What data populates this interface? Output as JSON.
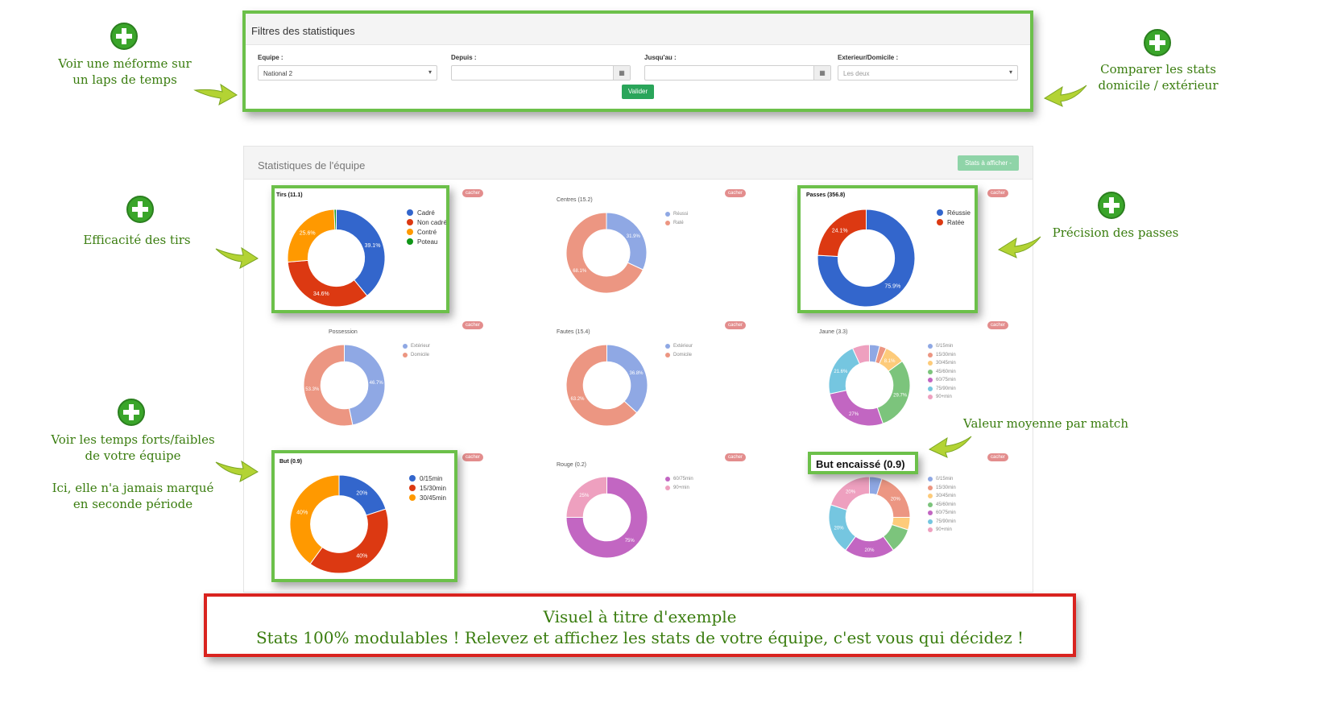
{
  "filters": {
    "title": "Filtres des statistiques",
    "team_label": "Equipe :",
    "team_value": "National 2",
    "from_label": "Depuis :",
    "from_value": "",
    "to_label": "Jusqu'au :",
    "to_value": "",
    "venue_label": "Exterieur/Domicile :",
    "venue_value": "Les deux",
    "submit_label": "Valider"
  },
  "stats_panel": {
    "title": "Statistiques de l'équipe",
    "display_button_label": "Stats à afficher -",
    "hide_label": "cacher"
  },
  "charts": [
    {
      "title": "Tirs (11.1)",
      "legend": [
        "Cadré",
        "Non cadré",
        "Contré",
        "Poteau"
      ],
      "colors": [
        "#3366cc",
        "#dc3912",
        "#ff9900",
        "#109618"
      ]
    },
    {
      "title": "Centres (15.2)",
      "legend": [
        "Réussi",
        "Raté"
      ],
      "colors": [
        "#8fa8e4",
        "#ec9682"
      ]
    },
    {
      "title": "Passes (356.8)",
      "legend": [
        "Réussie",
        "Ratée"
      ],
      "colors": [
        "#3366cc",
        "#dc3912"
      ]
    },
    {
      "title": "Possession",
      "legend": [
        "Extérieur",
        "Domicile"
      ],
      "colors": [
        "#8fa8e4",
        "#ec9682"
      ]
    },
    {
      "title": "Fautes (15.4)",
      "legend": [
        "Extérieur",
        "Domicile"
      ],
      "colors": [
        "#8fa8e4",
        "#ec9682"
      ]
    },
    {
      "title": "Jaune (3.3)",
      "legend": [
        "0/15min",
        "15/30min",
        "30/45min",
        "45/60min",
        "60/75min",
        "75/90min",
        "90+min"
      ],
      "colors": [
        "#8fa8e4",
        "#ec9682",
        "#fdcb7a",
        "#7cc47c",
        "#c266c2",
        "#75c6e0",
        "#eea0bf"
      ]
    },
    {
      "title": "But (0.9)",
      "legend": [
        "0/15min",
        "15/30min",
        "30/45min"
      ],
      "colors": [
        "#3366cc",
        "#dc3912",
        "#ff9900"
      ]
    },
    {
      "title": "Rouge (0.2)",
      "legend": [
        "60/75min",
        "90+min"
      ],
      "colors": [
        "#c266c2",
        "#eea0bf"
      ]
    },
    {
      "title": "But encaissé (0.9)",
      "legend": [
        "0/15min",
        "15/30min",
        "30/45min",
        "45/60min",
        "60/75min",
        "75/90min",
        "90+min"
      ],
      "colors": [
        "#8fa8e4",
        "#ec9682",
        "#fdcb7a",
        "#7cc47c",
        "#c266c2",
        "#75c6e0",
        "#eea0bf"
      ]
    }
  ],
  "chart_data": [
    {
      "type": "pie",
      "title": "Tirs (11.1)",
      "labels": [
        "Cadré",
        "Non cadré",
        "Contré",
        "Poteau"
      ],
      "values": [
        39.1,
        34.6,
        25.6,
        0.7
      ],
      "slice_labels": [
        "39.1%",
        "34.6%",
        "25.6%",
        ""
      ]
    },
    {
      "type": "pie",
      "title": "Centres (15.2)",
      "labels": [
        "Réussi",
        "Raté"
      ],
      "values": [
        31.9,
        68.1
      ],
      "slice_labels": [
        "31.9%",
        "68.1%"
      ]
    },
    {
      "type": "pie",
      "title": "Passes (356.8)",
      "labels": [
        "Réussie",
        "Ratée"
      ],
      "values": [
        75.9,
        24.1
      ],
      "slice_labels": [
        "75.9%",
        "24.1%"
      ]
    },
    {
      "type": "pie",
      "title": "Possession",
      "labels": [
        "Extérieur",
        "Domicile"
      ],
      "values": [
        46.7,
        53.3
      ],
      "slice_labels": [
        "46.7%",
        "53.3%"
      ]
    },
    {
      "type": "pie",
      "title": "Fautes (15.4)",
      "labels": [
        "Extérieur",
        "Domicile"
      ],
      "values": [
        36.8,
        63.2
      ],
      "slice_labels": [
        "36.8%",
        "63.2%"
      ]
    },
    {
      "type": "pie",
      "title": "Jaune (3.3)",
      "labels": [
        "0/15min",
        "15/30min",
        "30/45min",
        "45/60min",
        "60/75min",
        "75/90min",
        "90+min"
      ],
      "values": [
        4.1,
        2.7,
        8.1,
        29.7,
        27,
        21.6,
        6.8
      ],
      "slice_labels": [
        "",
        "",
        "8.1%",
        "29.7%",
        "27%",
        "21.6%",
        ""
      ]
    },
    {
      "type": "pie",
      "title": "But (0.9)",
      "labels": [
        "0/15min",
        "15/30min",
        "30/45min"
      ],
      "values": [
        20,
        40,
        40
      ],
      "slice_labels": [
        "20%",
        "40%",
        "40%"
      ]
    },
    {
      "type": "pie",
      "title": "Rouge (0.2)",
      "labels": [
        "60/75min",
        "90+min"
      ],
      "values": [
        75,
        25
      ],
      "slice_labels": [
        "75%",
        "25%"
      ]
    },
    {
      "type": "pie",
      "title": "But encaissé (0.9)",
      "labels": [
        "0/15min",
        "15/30min",
        "30/45min",
        "45/60min",
        "60/75min",
        "75/90min",
        "90+min"
      ],
      "values": [
        5,
        20,
        5,
        10,
        20,
        20,
        20
      ],
      "slice_labels": [
        "",
        "20%",
        "",
        "",
        "20%",
        "20%",
        "20%"
      ]
    }
  ],
  "annotations": {
    "meforme": [
      "Voir une méforme sur",
      "un laps de temps"
    ],
    "compare": [
      "Comparer les stats",
      "domicile / extérieur"
    ],
    "tirs": "Efficacité des tirs",
    "passes": "Précision des passes",
    "moyenne": "Valeur moyenne par match",
    "temps": [
      "Voir les temps forts/faibles",
      "de votre équipe"
    ],
    "seconde": [
      "Ici, elle n'a jamais marqué",
      "en seconde période"
    ]
  },
  "footer": {
    "line1": "Visuel à titre d'exemple",
    "line2": "Stats 100% modulables ! Relevez et affichez les stats de votre équipe, c'est vous qui décidez !"
  }
}
